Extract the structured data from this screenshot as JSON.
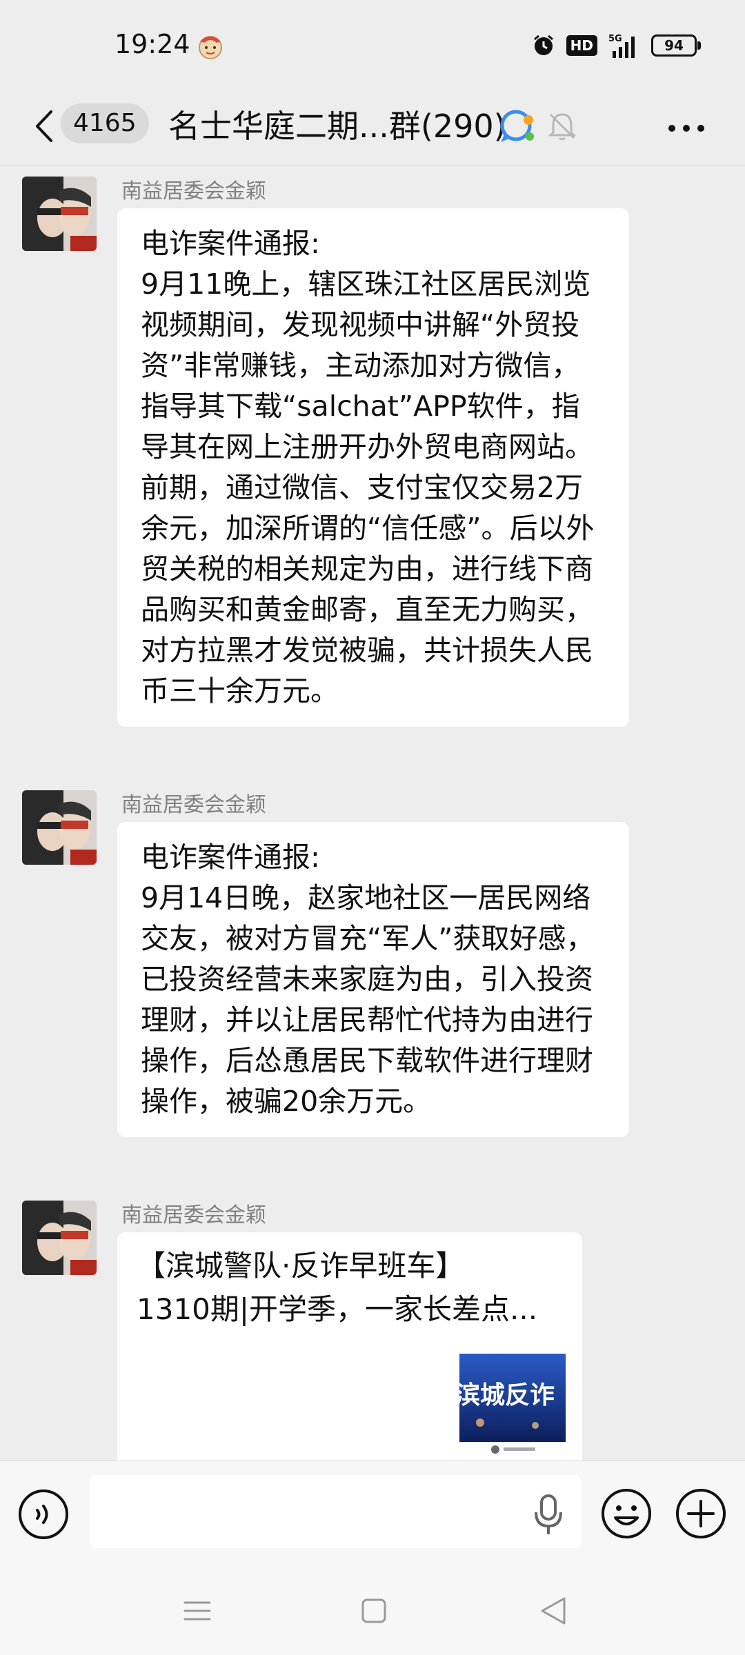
{
  "status_bar": {
    "time": "19:24",
    "hd": "HD",
    "network": "5G",
    "battery": "94"
  },
  "header": {
    "unread_count": "4165",
    "title": "名士华庭二期...群(290)"
  },
  "messages": [
    {
      "sender": "南益居委会金颖",
      "text": "电诈案件通报:\n9月11晚上，辖区珠江社区居民浏览视频期间，发现视频中讲解“外贸投资”非常赚钱，主动添加对方微信，指导其下载“salchat”APP软件，指导其在网上注册开办外贸电商网站。前期，通过微信、支付宝仅交易2万余元，加深所谓的“信任感”。后以外贸关税的相关规定为由，进行线下商品购买和黄金邮寄，直至无力购买，对方拉黑才发觉被骗，共计损失人民币三十余万元。"
    },
    {
      "sender": "南益居委会金颖",
      "text": "电诈案件通报:\n9月14日晚，赵家地社区一居民网络交友，被对方冒充“军人”获取好感，已投资经营未来家庭为由，引入投资理财，并以让居民帮忙代持为由进行操作，后怂恿居民下载软件进行理财操作，被骗20余万元。"
    },
    {
      "sender": "南益居委会金颖",
      "card_title": "【滨城警队·反诈早班车】",
      "card_subtitle": "1310期|开学季，一家长差点...",
      "thumb_text": "滨城反诈"
    }
  ],
  "input": {
    "value": "",
    "placeholder": ""
  },
  "icons": {
    "back": "chevron-left-icon",
    "group": "group-chat-icon",
    "mute": "bell-off-icon",
    "more": "more-dots-icon",
    "voice": "voice-icon",
    "mic": "microphone-icon",
    "emoji": "emoji-icon",
    "plus": "plus-icon"
  },
  "colors": {
    "background": "#ededed",
    "bubble": "#ffffff",
    "sender": "#808080"
  }
}
